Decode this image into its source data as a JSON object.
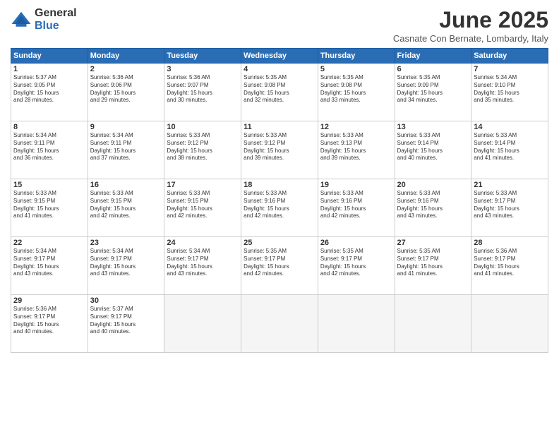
{
  "logo": {
    "general": "General",
    "blue": "Blue"
  },
  "title": "June 2025",
  "subtitle": "Casnate Con Bernate, Lombardy, Italy",
  "headers": [
    "Sunday",
    "Monday",
    "Tuesday",
    "Wednesday",
    "Thursday",
    "Friday",
    "Saturday"
  ],
  "days": [
    {
      "num": "",
      "empty": true
    },
    {
      "num": "",
      "empty": true
    },
    {
      "num": "",
      "empty": true
    },
    {
      "num": "",
      "empty": true
    },
    {
      "num": "",
      "empty": true
    },
    {
      "num": "",
      "empty": true
    },
    {
      "num": "",
      "empty": true
    },
    {
      "num": "1",
      "rise": "5:37 AM",
      "set": "9:05 PM",
      "daylight": "15 hours and 28 minutes."
    },
    {
      "num": "2",
      "rise": "5:36 AM",
      "set": "9:06 PM",
      "daylight": "15 hours and 29 minutes."
    },
    {
      "num": "3",
      "rise": "5:36 AM",
      "set": "9:07 PM",
      "daylight": "15 hours and 30 minutes."
    },
    {
      "num": "4",
      "rise": "5:35 AM",
      "set": "9:08 PM",
      "daylight": "15 hours and 32 minutes."
    },
    {
      "num": "5",
      "rise": "5:35 AM",
      "set": "9:08 PM",
      "daylight": "15 hours and 33 minutes."
    },
    {
      "num": "6",
      "rise": "5:35 AM",
      "set": "9:09 PM",
      "daylight": "15 hours and 34 minutes."
    },
    {
      "num": "7",
      "rise": "5:34 AM",
      "set": "9:10 PM",
      "daylight": "15 hours and 35 minutes."
    },
    {
      "num": "8",
      "rise": "5:34 AM",
      "set": "9:11 PM",
      "daylight": "15 hours and 36 minutes."
    },
    {
      "num": "9",
      "rise": "5:34 AM",
      "set": "9:11 PM",
      "daylight": "15 hours and 37 minutes."
    },
    {
      "num": "10",
      "rise": "5:33 AM",
      "set": "9:12 PM",
      "daylight": "15 hours and 38 minutes."
    },
    {
      "num": "11",
      "rise": "5:33 AM",
      "set": "9:12 PM",
      "daylight": "15 hours and 39 minutes."
    },
    {
      "num": "12",
      "rise": "5:33 AM",
      "set": "9:13 PM",
      "daylight": "15 hours and 39 minutes."
    },
    {
      "num": "13",
      "rise": "5:33 AM",
      "set": "9:14 PM",
      "daylight": "15 hours and 40 minutes."
    },
    {
      "num": "14",
      "rise": "5:33 AM",
      "set": "9:14 PM",
      "daylight": "15 hours and 41 minutes."
    },
    {
      "num": "15",
      "rise": "5:33 AM",
      "set": "9:15 PM",
      "daylight": "15 hours and 41 minutes."
    },
    {
      "num": "16",
      "rise": "5:33 AM",
      "set": "9:15 PM",
      "daylight": "15 hours and 42 minutes."
    },
    {
      "num": "17",
      "rise": "5:33 AM",
      "set": "9:15 PM",
      "daylight": "15 hours and 42 minutes."
    },
    {
      "num": "18",
      "rise": "5:33 AM",
      "set": "9:16 PM",
      "daylight": "15 hours and 42 minutes."
    },
    {
      "num": "19",
      "rise": "5:33 AM",
      "set": "9:16 PM",
      "daylight": "15 hours and 42 minutes."
    },
    {
      "num": "20",
      "rise": "5:33 AM",
      "set": "9:16 PM",
      "daylight": "15 hours and 43 minutes."
    },
    {
      "num": "21",
      "rise": "5:33 AM",
      "set": "9:17 PM",
      "daylight": "15 hours and 43 minutes."
    },
    {
      "num": "22",
      "rise": "5:34 AM",
      "set": "9:17 PM",
      "daylight": "15 hours and 43 minutes."
    },
    {
      "num": "23",
      "rise": "5:34 AM",
      "set": "9:17 PM",
      "daylight": "15 hours and 43 minutes."
    },
    {
      "num": "24",
      "rise": "5:34 AM",
      "set": "9:17 PM",
      "daylight": "15 hours and 43 minutes."
    },
    {
      "num": "25",
      "rise": "5:35 AM",
      "set": "9:17 PM",
      "daylight": "15 hours and 42 minutes."
    },
    {
      "num": "26",
      "rise": "5:35 AM",
      "set": "9:17 PM",
      "daylight": "15 hours and 42 minutes."
    },
    {
      "num": "27",
      "rise": "5:35 AM",
      "set": "9:17 PM",
      "daylight": "15 hours and 41 minutes."
    },
    {
      "num": "28",
      "rise": "5:36 AM",
      "set": "9:17 PM",
      "daylight": "15 hours and 41 minutes."
    },
    {
      "num": "29",
      "rise": "5:36 AM",
      "set": "9:17 PM",
      "daylight": "15 hours and 40 minutes."
    },
    {
      "num": "30",
      "rise": "5:37 AM",
      "set": "9:17 PM",
      "daylight": "15 hours and 40 minutes."
    },
    {
      "num": "",
      "empty": true
    },
    {
      "num": "",
      "empty": true
    },
    {
      "num": "",
      "empty": true
    },
    {
      "num": "",
      "empty": true
    },
    {
      "num": "",
      "empty": true
    }
  ]
}
